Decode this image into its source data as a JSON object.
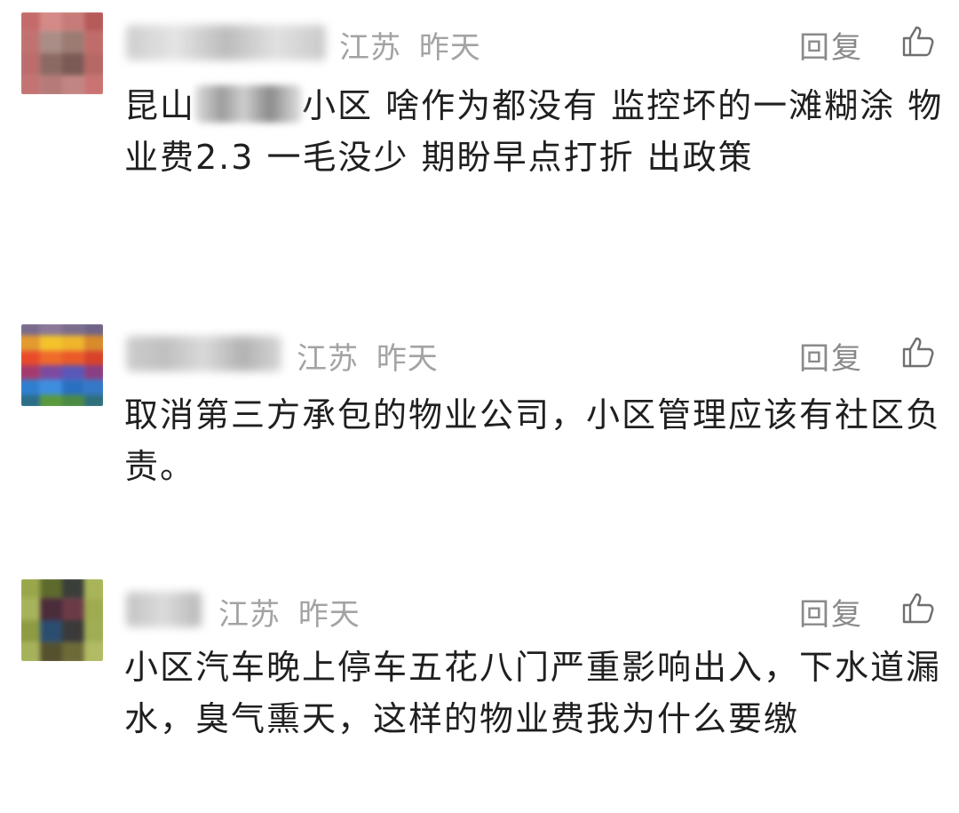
{
  "comments": [
    {
      "location": "江苏",
      "time": "昨天",
      "reply_label": "回复",
      "text_before": "昆山",
      "text_after": "小区  啥作为都没有  监控坏的一滩糊涂  物业费2.3  一毛没少  期盼早点打折 出政策"
    },
    {
      "location": "江苏",
      "time": "昨天",
      "reply_label": "回复",
      "text": "取消第三方承包的物业公司，小区管理应该有社区负责。"
    },
    {
      "location": "江苏",
      "time": "昨天",
      "reply_label": "回复",
      "text": "小区汽车晚上停车五花八门严重影响出入，下水道漏水，臭气熏天，这样的物业费我为什么要缴"
    }
  ],
  "icons": {
    "like": "thumbs-up-icon"
  },
  "colors": {
    "meta": "#a3a3a3",
    "reply": "#8a8a8a",
    "text": "#1f1f1f"
  }
}
